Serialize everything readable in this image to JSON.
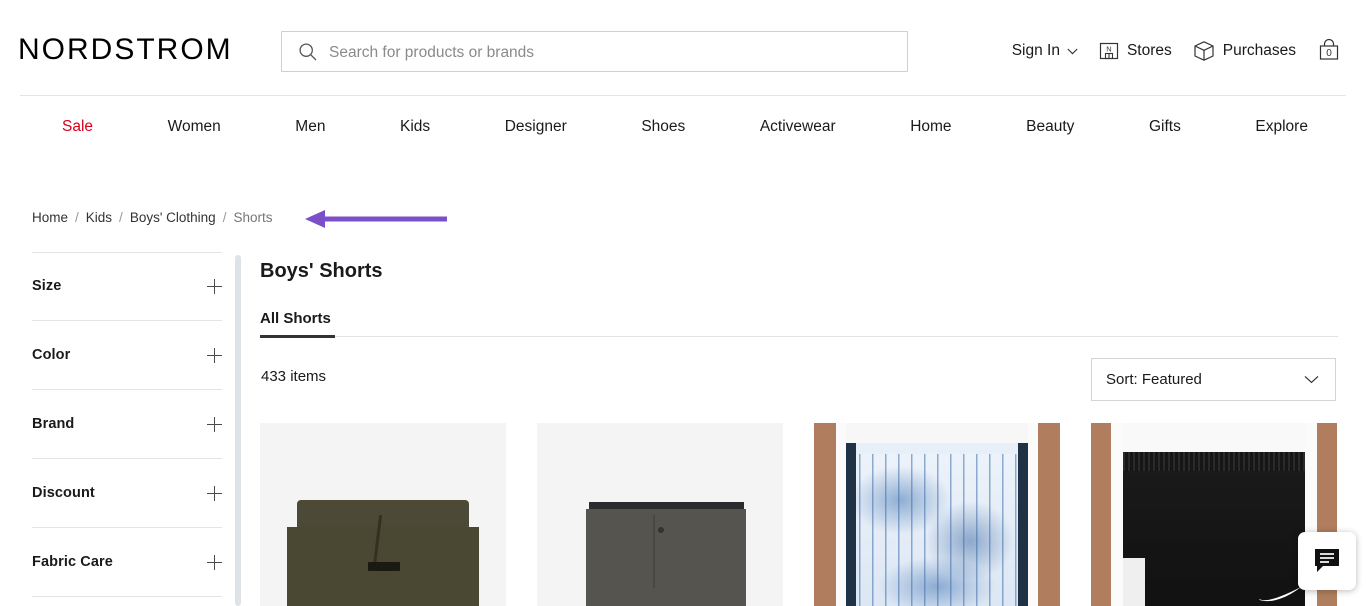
{
  "header": {
    "logo": "NORDSTROM",
    "search": {
      "placeholder": "Search for products or brands",
      "value": "",
      "icon": "search-icon"
    },
    "sign_in": "Sign In",
    "stores": "Stores",
    "stores_icon_letter": "N",
    "purchases": "Purchases",
    "bag_count": "0"
  },
  "nav": {
    "items": [
      {
        "label": "Sale",
        "color": "#d5011b"
      },
      {
        "label": "Women"
      },
      {
        "label": "Men"
      },
      {
        "label": "Kids"
      },
      {
        "label": "Designer"
      },
      {
        "label": "Shoes"
      },
      {
        "label": "Activewear"
      },
      {
        "label": "Home"
      },
      {
        "label": "Beauty"
      },
      {
        "label": "Gifts"
      },
      {
        "label": "Explore"
      }
    ]
  },
  "breadcrumb": {
    "items": [
      "Home",
      "Kids",
      "Boys' Clothing",
      "Shorts"
    ],
    "separator": "/",
    "current_index": 3
  },
  "annotation": {
    "type": "arrow",
    "direction": "left",
    "color": "#7B4FC9",
    "points_at": "Shorts"
  },
  "sidebar": {
    "filters": [
      {
        "label": "Size",
        "expander": "plus-icon"
      },
      {
        "label": "Color",
        "expander": "plus-icon"
      },
      {
        "label": "Brand",
        "expander": "plus-icon"
      },
      {
        "label": "Discount",
        "expander": "plus-icon"
      },
      {
        "label": "Fabric Care",
        "expander": "plus-icon"
      }
    ]
  },
  "main": {
    "title": "Boys' Shorts",
    "tabs": [
      {
        "label": "All Shorts",
        "active": true
      }
    ],
    "item_count": "433 items",
    "sort": {
      "label": "Sort: Featured",
      "icon": "chevron-down-icon"
    }
  },
  "products": [
    {
      "name": "olive-sweat-shorts",
      "alt": "Olive green sweat shorts with drawstring"
    },
    {
      "name": "gray-chino-shorts",
      "alt": "Dark gray chino shorts with button waistband"
    },
    {
      "name": "blue-marble-print-shorts",
      "alt": "Blue marble print basketball shorts on model"
    },
    {
      "name": "black-mesh-shorts",
      "alt": "Black mesh athletic shorts on model"
    }
  ],
  "chat_widget": {
    "icon": "chat-bubble-icon",
    "label": "Chat"
  }
}
